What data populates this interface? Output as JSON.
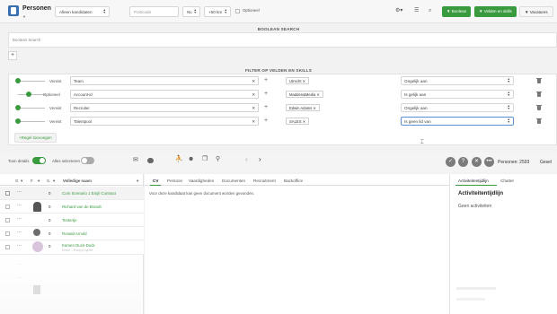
{
  "header": {
    "title": "Personen",
    "candidate_filter": "Alleen kandidaten",
    "postcode_placeholder": "Postcode",
    "country": "NL",
    "radius": "+50 km",
    "optioneel_label": "Optioneel",
    "boolean_button": "Boolean",
    "fields_skills_button": "Velden en skills",
    "vacancies_button": "Vacatures"
  },
  "boolean_search": {
    "heading": "BOOLEAN SEARCH",
    "placeholder": "Boolean Search"
  },
  "filter": {
    "heading": "FILTER OP VELDEN EN SKILLS",
    "rows": [
      {
        "mode": "Vereist",
        "field": "Team",
        "tag": "Utrecht",
        "condition": "Ongelijk aan"
      },
      {
        "mode": "Optioneel",
        "field": "Account-id",
        "tag": "Madden&Media",
        "condition": "Is gelijk aan"
      },
      {
        "mode": "Vereist",
        "field": "Recruiter",
        "tag": "Edwin Adams",
        "condition": "Ongelijk aan"
      },
      {
        "mode": "Vereist",
        "field": "Talentpool",
        "tag": "SALES",
        "condition": "Is geen lid van"
      }
    ],
    "add_rule": "Regel toevoegen"
  },
  "toolbar": {
    "show_details": "Toon details",
    "select_all": "Alles selecteren",
    "persons_count": "Personen: 2593",
    "truncated_label": "Gesel"
  },
  "grid": {
    "columns": [
      "G",
      "F.",
      "S.",
      "Volledige naam"
    ],
    "rows": [
      {
        "score": "0",
        "name": "Com Scenario 1 Emjil Contract",
        "sub": ""
      },
      {
        "score": "0",
        "name": "Richard van de Brandt",
        "sub": ""
      },
      {
        "score": "0",
        "name": "Testertje",
        "sub": ""
      },
      {
        "score": "0",
        "name": "Ronald Arnold",
        "sub": ""
      },
      {
        "score": "0",
        "name": "Kamen Duck-Duck",
        "sub": "Emile ...Evelyn Lynne"
      }
    ]
  },
  "detail": {
    "tabs": [
      "CV",
      "Persoon",
      "Vaardigheden",
      "Documenten",
      "Recruitment",
      "Backoffice"
    ],
    "no_document_msg": "Voor deze kandidaat kan geen document worden gevonden.",
    "right_tabs": [
      "Activiteitentijdlijn",
      "Chatter"
    ],
    "timeline_title": "Activiteitentijdlijn",
    "no_activities": "Geen activiteiten"
  },
  "colors": {
    "accent_green": "#3a9a3e",
    "brand_blue": "#3b6db3"
  }
}
